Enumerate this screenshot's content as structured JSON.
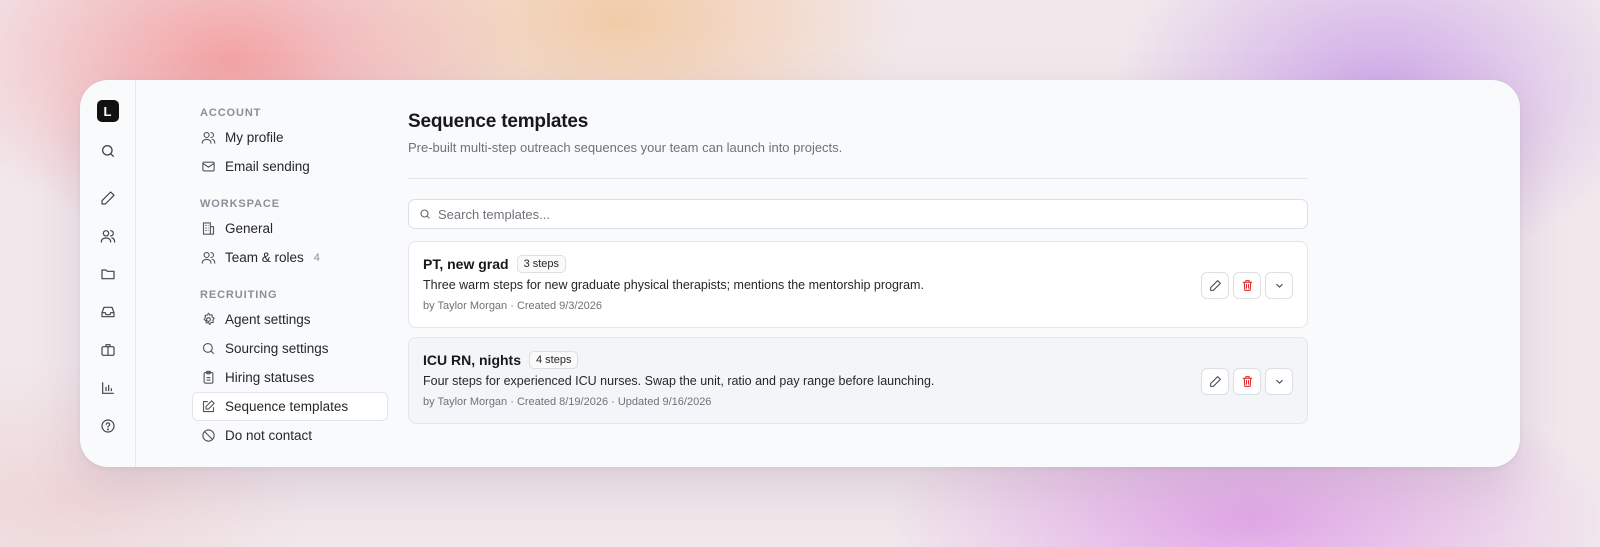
{
  "app": {
    "logo_letter": "L"
  },
  "rail": {
    "icons": [
      "search-icon",
      "pencil-icon",
      "users-icon",
      "folder-icon",
      "inbox-icon",
      "briefcase-icon",
      "bar-chart-icon",
      "help-icon"
    ]
  },
  "nav": {
    "account_label": "ACCOUNT",
    "account_items": [
      {
        "label": "My profile",
        "icon": "user-icon"
      },
      {
        "label": "Email sending",
        "icon": "mail-icon"
      }
    ],
    "workspace_label": "WORKSPACE",
    "workspace_items": [
      {
        "label": "General",
        "icon": "building-icon"
      },
      {
        "label": "Team & roles",
        "icon": "users-icon",
        "count": "4"
      }
    ],
    "recruiting_label": "RECRUITING",
    "recruiting_items": [
      {
        "label": "Agent settings",
        "icon": "gear-icon"
      },
      {
        "label": "Sourcing settings",
        "icon": "search-icon"
      },
      {
        "label": "Hiring statuses",
        "icon": "clipboard-icon"
      },
      {
        "label": "Sequence templates",
        "icon": "edit-icon",
        "active": true
      },
      {
        "label": "Do not contact",
        "icon": "ban-icon"
      }
    ]
  },
  "main": {
    "title": "Sequence templates",
    "subtitle": "Pre-built multi-step outreach sequences your team can launch into projects.",
    "search": {
      "placeholder": "Search templates...",
      "value": ""
    },
    "templates": [
      {
        "name": "PT, new grad",
        "steps": "3 steps",
        "description": "Three warm steps for new graduate physical therapists; mentions the mentorship program.",
        "meta": "by Taylor Morgan · Created 9/3/2026"
      },
      {
        "name": "ICU RN, nights",
        "steps": "4 steps",
        "description": "Four steps for experienced ICU nurses. Swap the unit, ratio and pay range before launching.",
        "meta": "by Taylor Morgan · Created 8/19/2026 · Updated 9/16/2026"
      }
    ]
  },
  "colors": {
    "danger": "#dc2626",
    "active_bg": "#ffffff",
    "window_bg": "#f9fafc"
  }
}
